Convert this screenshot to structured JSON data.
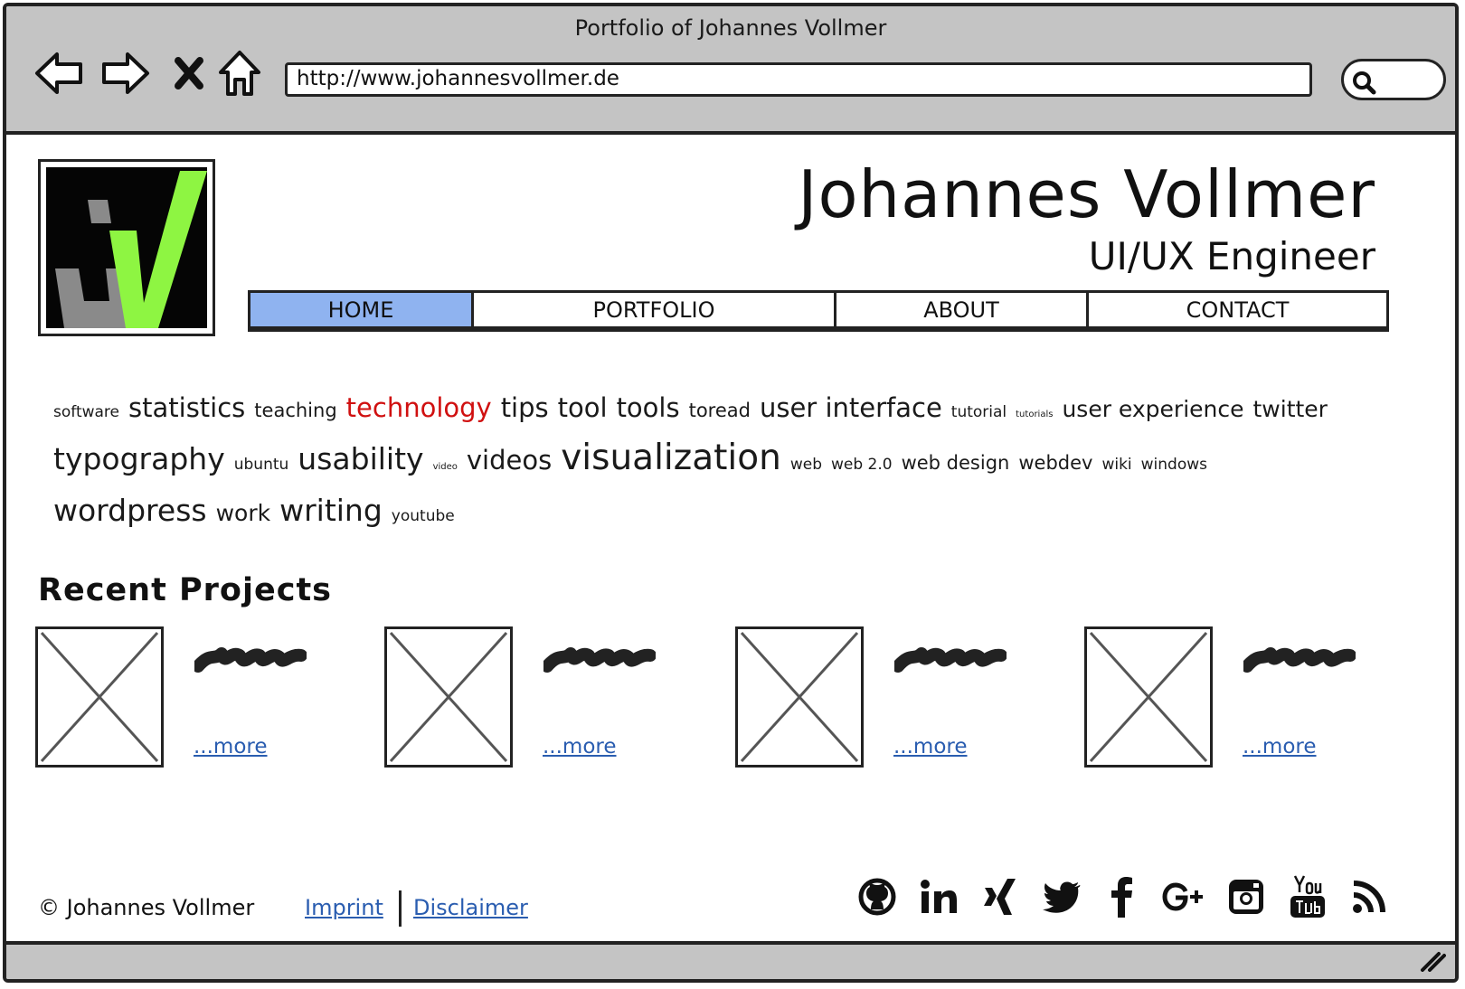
{
  "window": {
    "title": "Portfolio of Johannes Vollmer"
  },
  "browser": {
    "url": "http://www.johannesvollmer.de",
    "nav_icons": [
      "back-arrow-icon",
      "forward-arrow-icon",
      "stop-icon",
      "home-icon"
    ],
    "search_icon": "search-icon"
  },
  "header": {
    "name": "Johannes Vollmer",
    "role": "UI/UX Engineer",
    "logo": "jv-logo",
    "logo_colors": {
      "background": "#050505",
      "check": "#8ef542",
      "j": "#8a8a8a"
    }
  },
  "menu": {
    "items": [
      {
        "label": "HOME",
        "active": true
      },
      {
        "label": "PORTFOLIO",
        "active": false
      },
      {
        "label": "ABOUT",
        "active": false
      },
      {
        "label": "CONTACT",
        "active": false
      }
    ],
    "active_color": "#8fb3f0"
  },
  "tagcloud": {
    "tags": [
      {
        "label": "software",
        "weight": 1
      },
      {
        "label": "statistics",
        "weight": 4
      },
      {
        "label": "teaching",
        "weight": 2
      },
      {
        "label": "technology",
        "weight": 4,
        "highlight": true
      },
      {
        "label": "tips",
        "weight": 4
      },
      {
        "label": "tool",
        "weight": 4
      },
      {
        "label": "tools",
        "weight": 4
      },
      {
        "label": "toread",
        "weight": 2
      },
      {
        "label": "user interface",
        "weight": 4
      },
      {
        "label": "tutorial",
        "weight": 1
      },
      {
        "label": "tutorials",
        "weight": 0
      },
      {
        "label": "user experience",
        "weight": 3
      },
      {
        "label": "twitter",
        "weight": 3
      },
      {
        "label": "typography",
        "weight": 5
      },
      {
        "label": "ubuntu",
        "weight": 1
      },
      {
        "label": "usability",
        "weight": 5
      },
      {
        "label": "video",
        "weight": 0
      },
      {
        "label": "videos",
        "weight": 4
      },
      {
        "label": "visualization",
        "weight": 6
      },
      {
        "label": "web",
        "weight": 1
      },
      {
        "label": "web 2.0",
        "weight": 1
      },
      {
        "label": "web design",
        "weight": 2
      },
      {
        "label": "webdev",
        "weight": 2
      },
      {
        "label": "wiki",
        "weight": 1
      },
      {
        "label": "windows",
        "weight": 1
      },
      {
        "label": "wordpress",
        "weight": 5
      },
      {
        "label": "work",
        "weight": 3
      },
      {
        "label": "writing",
        "weight": 5
      },
      {
        "label": "youtube",
        "weight": 1
      }
    ],
    "highlight_color": "#d01010"
  },
  "projects": {
    "heading": "Recent Projects",
    "items": [
      {
        "more_label": "...more"
      },
      {
        "more_label": "...more"
      },
      {
        "more_label": "...more"
      },
      {
        "more_label": "...more"
      }
    ]
  },
  "footer": {
    "copyright": "© Johannes Vollmer",
    "imprint": "Imprint",
    "disclaimer": "Disclaimer",
    "link_color": "#2a5db0",
    "social_icons": [
      "github-icon",
      "linkedin-icon",
      "xing-icon",
      "twitter-icon",
      "facebook-icon",
      "google-plus-icon",
      "instagram-icon",
      "youtube-icon",
      "rss-icon"
    ]
  }
}
